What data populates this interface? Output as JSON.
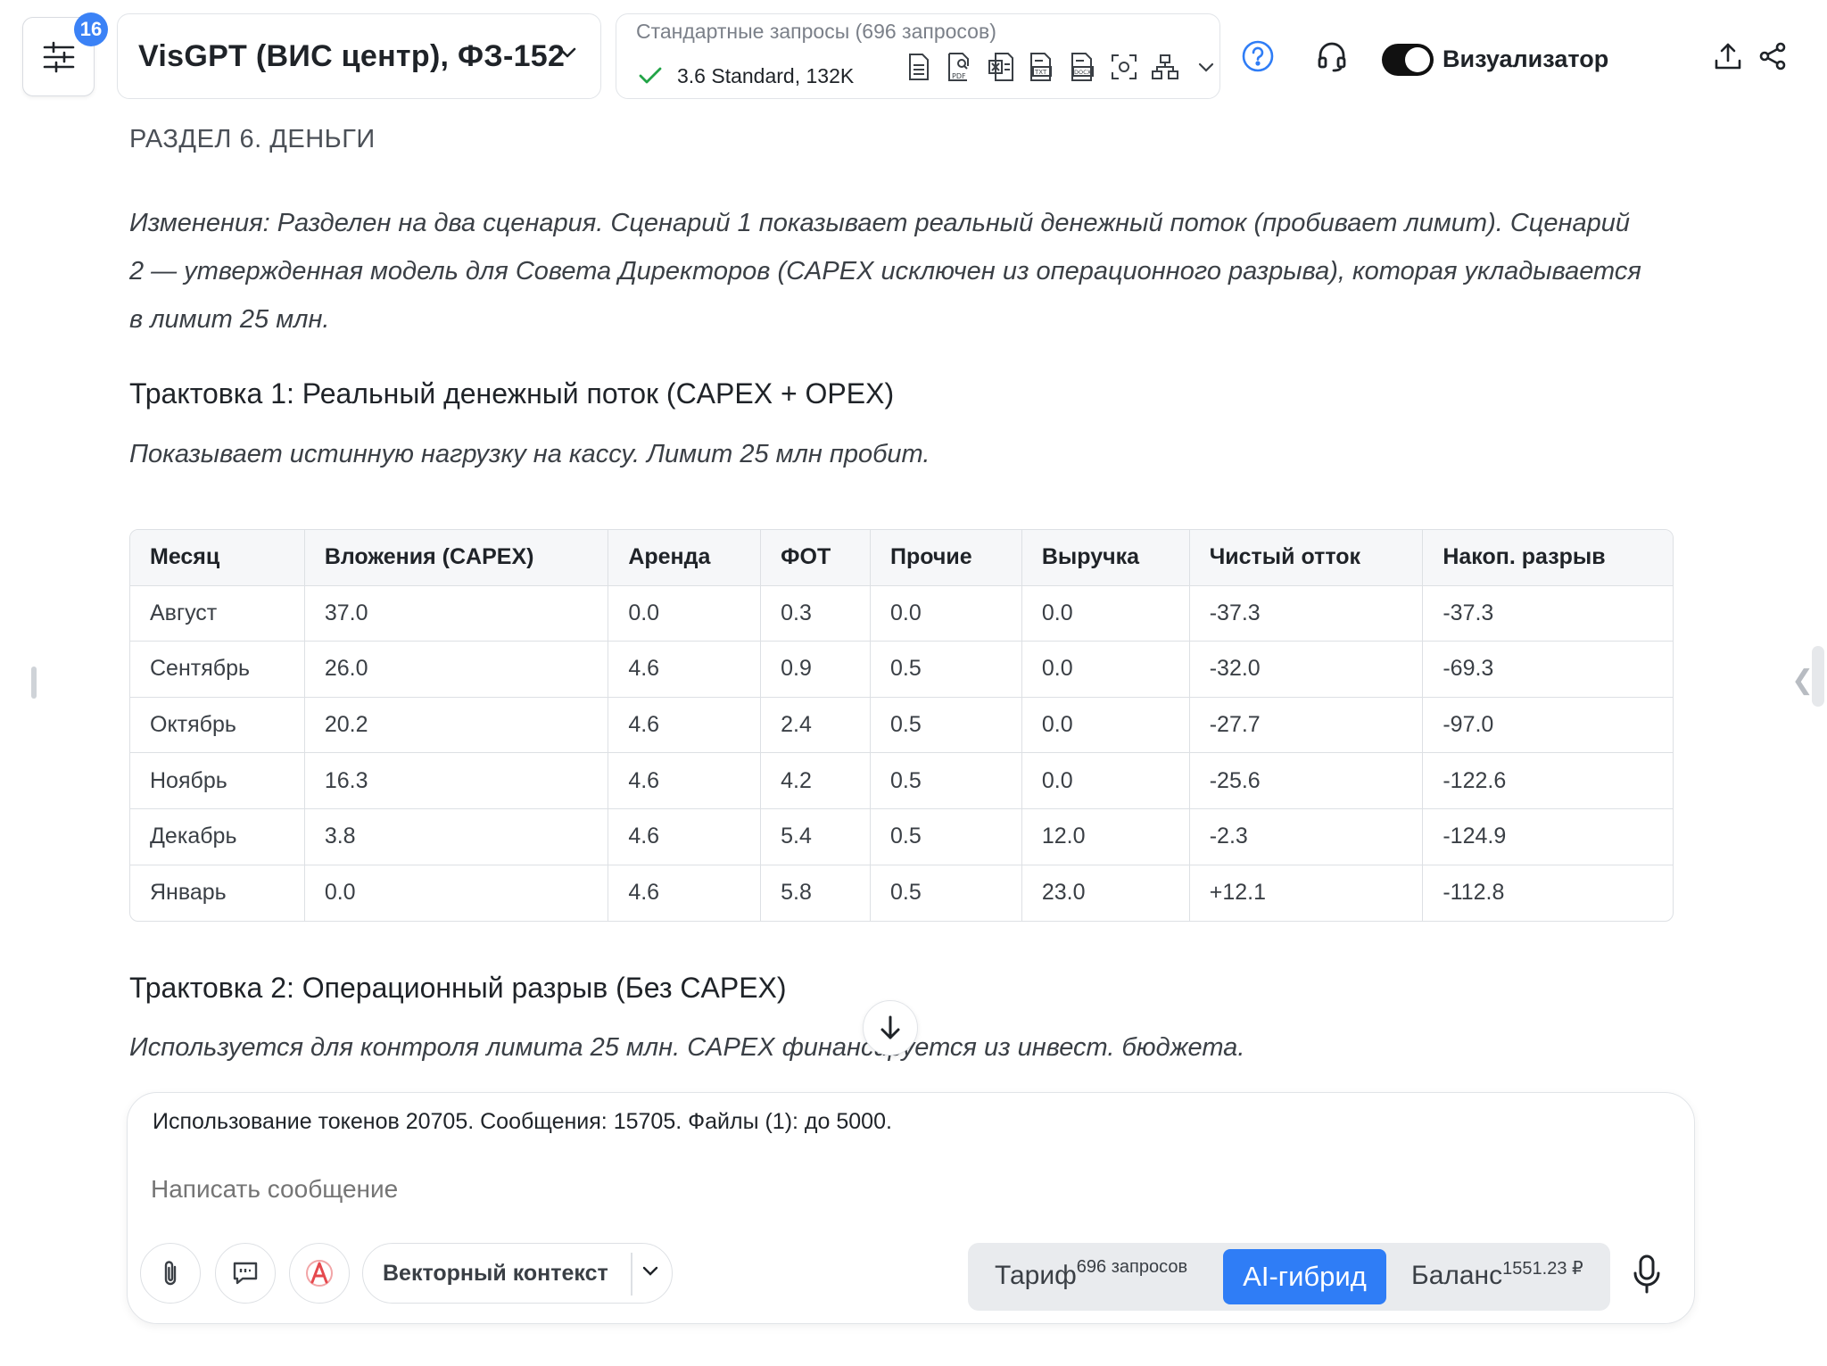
{
  "header": {
    "badge_count": "16",
    "model_name": "VisGPT (ВИС центр), ФЗ-152",
    "plan_title": "Стандартные запросы (696 запросов)",
    "plan_model": "3.6 Standard, 132K",
    "file_icons": [
      "doc-icon",
      "pdf-icon",
      "xls-icon",
      "txt-icon",
      "docx-icon",
      "scan-icon",
      "hierarchy-icon"
    ],
    "toggle_label": "Визуализатор",
    "toggle_on": true
  },
  "content": {
    "section_title": "РАЗДЕЛ 6. ДЕНЬГИ",
    "changes_line1": "Изменения: Разделен на два сценария. Сценарий 1 показывает реальный денежный поток (пробивает лимит). Сценарий",
    "changes_line2": "2 — утвержденная модель для Совета Директоров (CAPEX исключен из операционного разрыва), которая укладывается",
    "changes_line3": "в лимит 25 млн.",
    "interpretation1_title": "Трактовка 1: Реальный денежный поток (CAPEX + OPEX)",
    "interpretation1_subtitle": "Показывает истинную нагрузку на кассу. Лимит 25 млн пробит.",
    "interpretation2_title": "Трактовка 2: Операционный разрыв (Без CAPEX)",
    "interpretation2_subtitle": "Используется для контроля лимита 25 млн. CAPEX финансируется из инвест. бюджета."
  },
  "table": {
    "headers": [
      "Месяц",
      "Вложения (CAPEX)",
      "Аренда",
      "ФОТ",
      "Прочие",
      "Выручка",
      "Чистый отток",
      "Накоп. разрыв"
    ],
    "rows": [
      [
        "Август",
        "37.0",
        "0.0",
        "0.3",
        "0.0",
        "0.0",
        "-37.3",
        "-37.3"
      ],
      [
        "Сентябрь",
        "26.0",
        "4.6",
        "0.9",
        "0.5",
        "0.0",
        "-32.0",
        "-69.3"
      ],
      [
        "Октябрь",
        "20.2",
        "4.6",
        "2.4",
        "0.5",
        "0.0",
        "-27.7",
        "-97.0"
      ],
      [
        "Ноябрь",
        "16.3",
        "4.6",
        "4.2",
        "0.5",
        "0.0",
        "-25.6",
        "-122.6"
      ],
      [
        "Декабрь",
        "3.8",
        "4.6",
        "5.4",
        "0.5",
        "12.0",
        "-2.3",
        "-124.9"
      ],
      [
        "Январь",
        "0.0",
        "4.6",
        "5.8",
        "0.5",
        "23.0",
        "+12.1",
        "-112.8"
      ]
    ]
  },
  "composer": {
    "usage_text": "Использование токенов 20705. Сообщения: 15705. Файлы (1): до 5000.",
    "input_placeholder": "Написать сообщение",
    "context_label": "Векторный контекст",
    "tarif_label": "Тариф",
    "tarif_sup": "696 запросов",
    "ai_label": "AI-гибрид",
    "balance_label": "Баланс",
    "balance_sup": "1551.23 ₽"
  },
  "colors": {
    "accent": "#2f7df6",
    "badge": "#3b82f6",
    "check": "#22a447",
    "anti_red": "#e5484d"
  }
}
